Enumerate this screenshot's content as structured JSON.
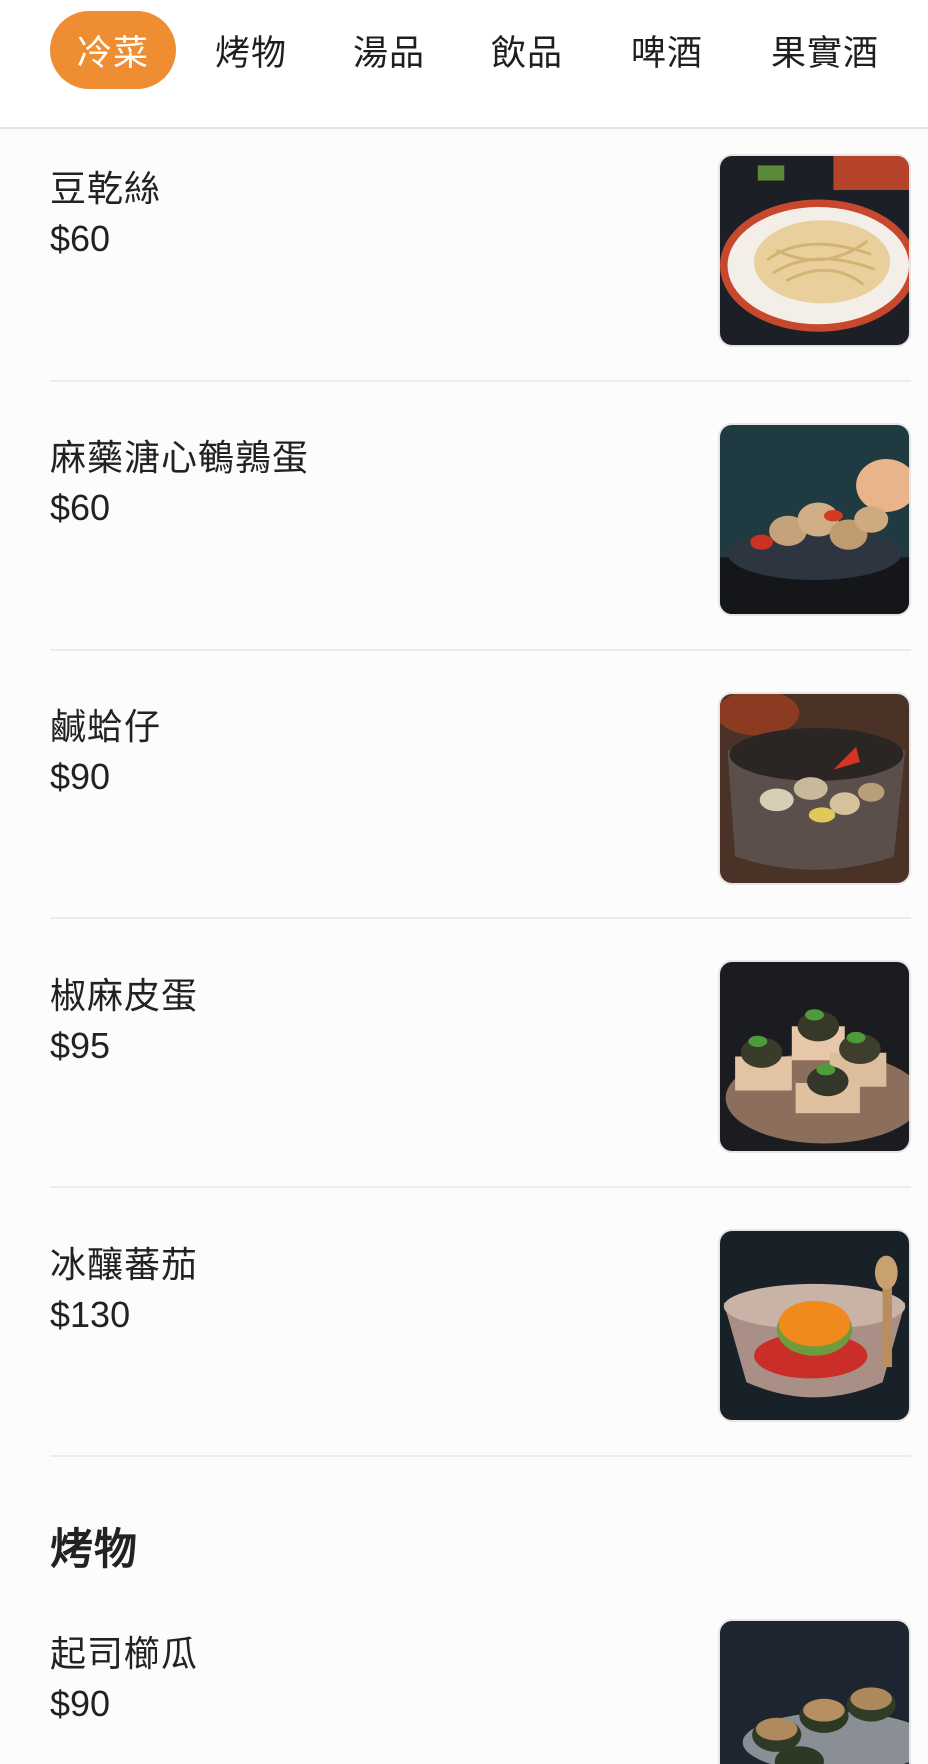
{
  "tabs": [
    {
      "label": "冷菜",
      "active": true
    },
    {
      "label": "烤物",
      "active": false
    },
    {
      "label": "湯品",
      "active": false
    },
    {
      "label": "飲品",
      "active": false
    },
    {
      "label": "啤酒",
      "active": false
    },
    {
      "label": "果實酒",
      "active": false
    }
  ],
  "items": [
    {
      "name": "豆乾絲",
      "price": "$60",
      "photo": "dried-tofu-strips-photo"
    },
    {
      "name": "麻藥溏心鵪鶉蛋",
      "price": "$60",
      "photo": "marinated-quail-eggs-photo"
    },
    {
      "name": "鹹蛤仔",
      "price": "$90",
      "photo": "salted-clams-photo"
    },
    {
      "name": "椒麻皮蛋",
      "price": "$95",
      "photo": "spicy-century-egg-photo"
    },
    {
      "name": "冰釀蕃茄",
      "price": "$130",
      "photo": "chilled-tomato-photo"
    }
  ],
  "section_grill": {
    "heading": "烤物",
    "items": [
      {
        "name": "起司櫛瓜",
        "price": "$90",
        "photo": "cheese-zucchini-photo"
      }
    ]
  },
  "colors": {
    "accent": "#ef8d32"
  }
}
